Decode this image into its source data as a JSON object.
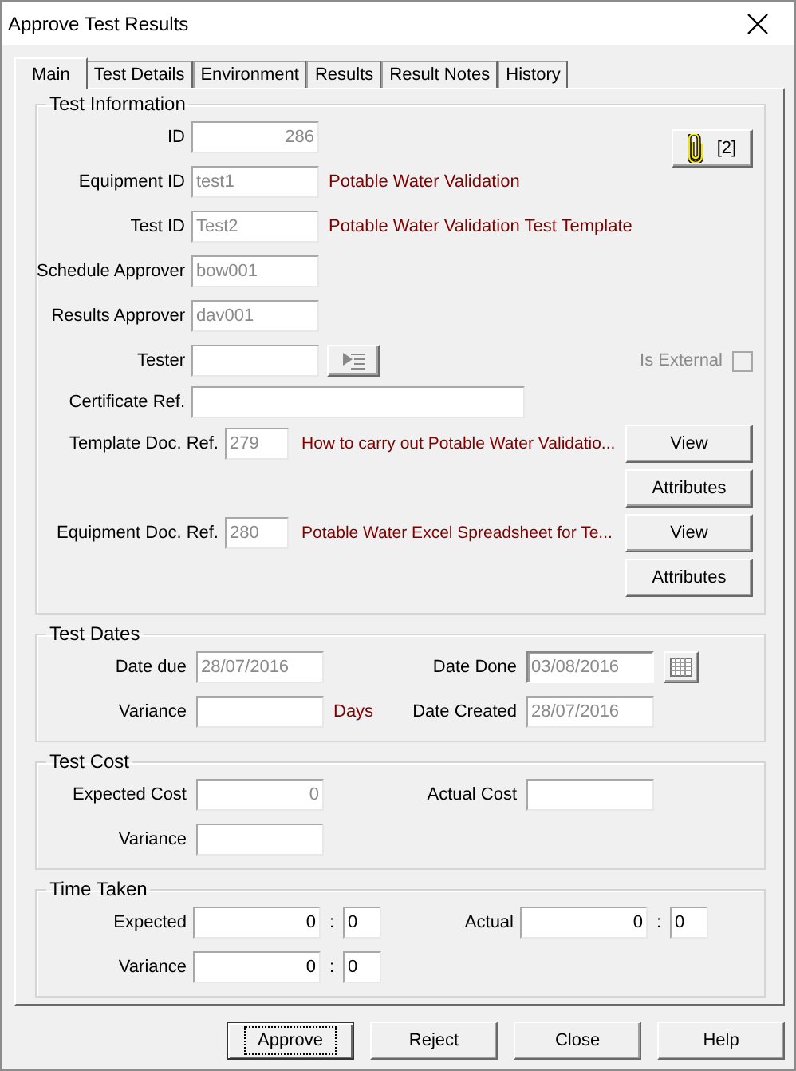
{
  "window": {
    "title": "Approve Test Results"
  },
  "tabs": [
    {
      "label": "Main",
      "selected": true
    },
    {
      "label": "Test Details",
      "selected": false
    },
    {
      "label": "Environment",
      "selected": false
    },
    {
      "label": "Results",
      "selected": false
    },
    {
      "label": "Result Notes",
      "selected": false
    },
    {
      "label": "History",
      "selected": false
    }
  ],
  "test_information": {
    "title": "Test Information",
    "attachments_button": {
      "label": "[2]"
    },
    "fields": [
      {
        "label": "ID",
        "value": "286",
        "kind": "number",
        "disabled": true
      },
      {
        "label": "Equipment ID",
        "value": "test1",
        "kind": "text",
        "disabled": true,
        "description": "Potable Water Validation"
      },
      {
        "label": "Test ID",
        "value": "Test2",
        "kind": "text",
        "disabled": true,
        "description": "Potable Water Validation Test Template"
      },
      {
        "label": "Schedule Approver",
        "value": "bow001",
        "kind": "text",
        "disabled": true
      },
      {
        "label": "Results Approver",
        "value": "dav001",
        "kind": "text",
        "disabled": true
      }
    ],
    "tester": {
      "label": "Tester"
    },
    "is_external": {
      "label": "Is External",
      "checked": false,
      "disabled": true
    },
    "certificate_ref": {
      "label": "Certificate Ref."
    },
    "documents": [
      {
        "label": "Template Doc. Ref.",
        "value": "279",
        "description": "How to carry out Potable Water Validatio...",
        "buttons": [
          "View",
          "Attributes"
        ]
      },
      {
        "label": "Equipment Doc. Ref.",
        "value": "280",
        "description": "Potable Water Excel Spreadsheet for Te...",
        "buttons": [
          "View",
          "Attributes"
        ]
      }
    ]
  },
  "test_dates": {
    "title": "Test Dates",
    "date_due": {
      "label": "Date due",
      "value": "28/07/2016",
      "disabled": true
    },
    "date_done": {
      "label": "Date Done",
      "value": "03/08/2016",
      "disabled": true
    },
    "variance": {
      "label": "Variance",
      "unit": "Days"
    },
    "date_created": {
      "label": "Date Created",
      "value": "28/07/2016",
      "disabled": true
    }
  },
  "test_cost": {
    "title": "Test Cost",
    "expected_cost": {
      "label": "Expected Cost",
      "value": "0",
      "kind": "number",
      "disabled": true
    },
    "actual_cost": {
      "label": "Actual Cost"
    },
    "variance": {
      "label": "Variance"
    }
  },
  "time_taken": {
    "title": "Time Taken",
    "expected": {
      "label": "Expected",
      "hours": "0",
      "separator": ":",
      "minutes": "0"
    },
    "actual": {
      "label": "Actual",
      "hours": "0",
      "separator": ":",
      "minutes": "0"
    },
    "variance": {
      "label": "Variance",
      "hours": "0",
      "separator": ":",
      "minutes": "0"
    }
  },
  "buttons": [
    {
      "label": "Approve",
      "default": true
    },
    {
      "label": "Reject",
      "default": false
    },
    {
      "label": "Close",
      "default": false
    },
    {
      "label": "Help",
      "default": false
    }
  ]
}
